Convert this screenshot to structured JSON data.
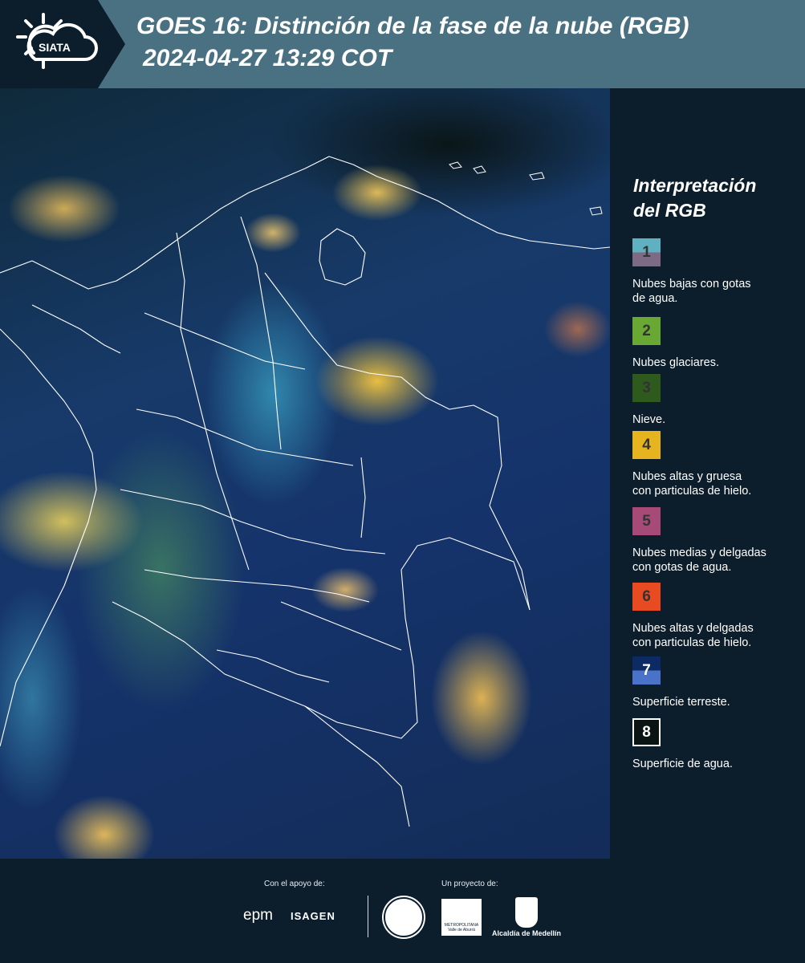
{
  "header": {
    "title_line1": "GOES 16: Distinción de la fase de la nube (RGB)",
    "title_line2": "2024-04-27 13:29 COT",
    "logo_text": "SIATA"
  },
  "map": {
    "background_color": "#15336b",
    "border_color": "#ffffff"
  },
  "legend": {
    "title_line1": "Interpretación",
    "title_line2": "del RGB",
    "items": [
      {
        "number": "1",
        "label_line1": "Nubes bajas con gotas",
        "label_line2": "de agua.",
        "color_top": "#5fb0c0",
        "color_bottom": "#7d6a84"
      },
      {
        "number": "2",
        "label_line1": "Nubes glaciares.",
        "label_line2": "",
        "color_top": "#6aa834",
        "color_bottom": "#6aa834"
      },
      {
        "number": "3",
        "label_line1": "Nieve.",
        "label_line2": "",
        "color_top": "#2e5a1e",
        "color_bottom": "#2e5a1e"
      },
      {
        "number": "4",
        "label_line1": "Nubes altas y gruesa",
        "label_line2": "con particulas de hielo.",
        "color_top": "#e6b41e",
        "color_bottom": "#e6b41e"
      },
      {
        "number": "5",
        "label_line1": "Nubes medias y delgadas",
        "label_line2": "con gotas de agua.",
        "color_top": "#a84a78",
        "color_bottom": "#a84a78"
      },
      {
        "number": "6",
        "label_line1": "Nubes altas y delgadas",
        "label_line2": "con particulas de hielo.",
        "color_top": "#e84a22",
        "color_bottom": "#e84a22"
      },
      {
        "number": "7",
        "label_line1": "Superficie terreste.",
        "label_line2": "",
        "color_top": "#0c2a64",
        "color_bottom": "#4a72c8"
      },
      {
        "number": "8",
        "label_line1": "Superficie de agua.",
        "label_line2": "",
        "color_top": "#0a1412",
        "color_bottom": "#0a1412"
      }
    ]
  },
  "footer": {
    "support_label": "Con el apoyo de:",
    "project_label": "Un proyecto de:",
    "epm": "epm",
    "isagen": "ISAGEN",
    "metro_line1": "METROPOLITANA",
    "metro_line2": "Valle de Aburrá",
    "alcaldia": "Alcaldía de Medellín"
  }
}
